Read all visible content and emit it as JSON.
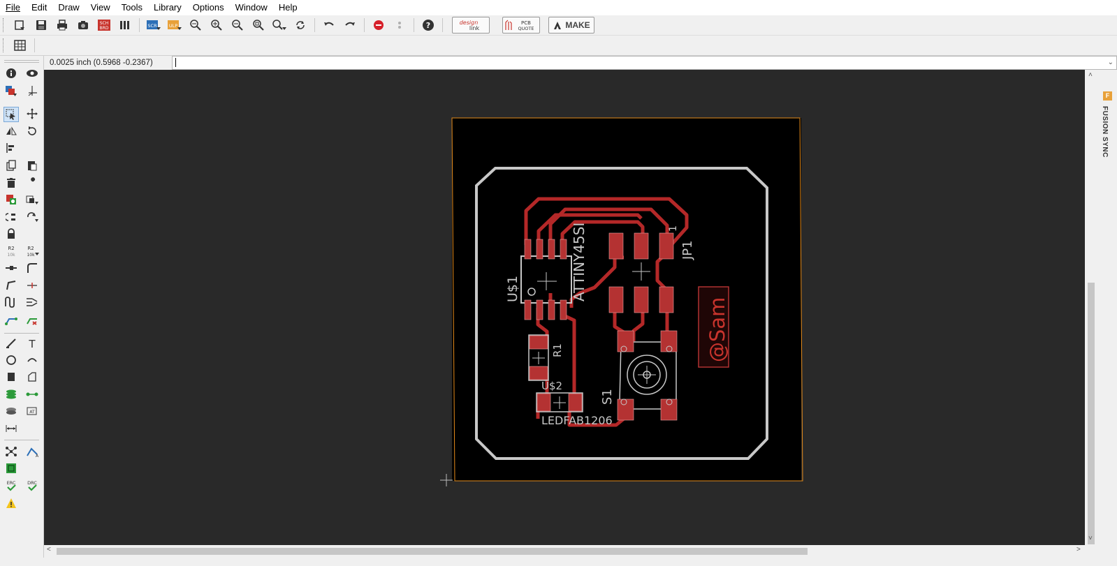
{
  "menu": [
    "File",
    "Edit",
    "Draw",
    "View",
    "Tools",
    "Library",
    "Options",
    "Window",
    "Help"
  ],
  "toolbar": {
    "design_link_top": "design",
    "design_link_bottom": "link",
    "pcb_quote_top": "PCB",
    "pcb_quote_bottom": "QUOTE",
    "make_label": "MAKE",
    "sch_label_top": "SCH",
    "sch_label_bottom": "BRD",
    "scr_label": "SCR",
    "ulp_label": "ULP"
  },
  "coordinates": "0.0025 inch (0.5968 -0.2367)",
  "side_panel": {
    "fusion_sync": "FUSION SYNC",
    "icon": "F"
  },
  "left_tools": {
    "erc_label": "ERC",
    "drc_label": "DRC",
    "r2_label": "R2",
    "r2_value": "10k",
    "text_tool": "T"
  },
  "board": {
    "labels": {
      "u1": "U$1",
      "attiny": "ATTINY45SI",
      "jp1": "JP1",
      "pin1": "1",
      "r1": "R1",
      "u2": "U$2",
      "led": "LEDFAB1206",
      "s1": "S1",
      "sam": "@Sam"
    },
    "colors": {
      "background": "#292929",
      "board": "#000000",
      "outline": "#c8c8c8",
      "trace": "#b42828",
      "pad": "#b43232",
      "dimension": "#e48a1a",
      "silk": "#c8c8c8"
    }
  }
}
